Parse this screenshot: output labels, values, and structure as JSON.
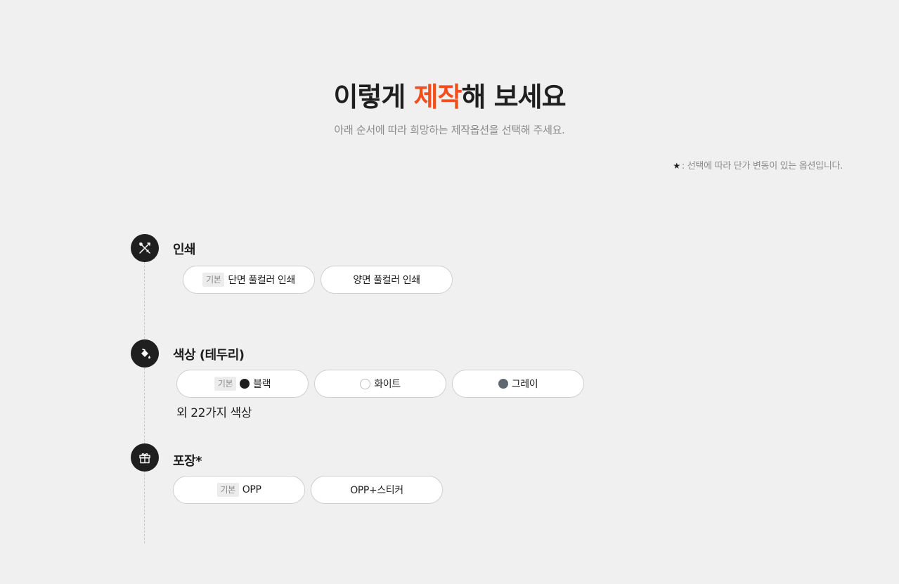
{
  "header": {
    "title_prefix": "이렇게 ",
    "title_accent": "제작",
    "title_suffix": "해 보세요",
    "subtitle": "아래 순서에 따라 희망하는 제작옵션을 선택해 주세요."
  },
  "note": {
    "star": "★",
    "text": ": 선택에 따라 단가 변동이 있는 옵션입니다."
  },
  "colors": {
    "accent": "#f24e1e",
    "dark": "#1f1f1f",
    "muted": "#8b8b8b",
    "background": "#f0f0f0"
  },
  "steps": [
    {
      "icon": "scissors-pencil-icon",
      "title": "인쇄",
      "options": [
        {
          "badge": "기본",
          "label": "단면 풀컬러 인쇄"
        },
        {
          "label": "양면 풀컬러 인쇄"
        }
      ]
    },
    {
      "icon": "paint-bucket-icon",
      "title": "색상 (테두리)",
      "options": [
        {
          "badge": "기본",
          "swatch": "#1f1f1f",
          "label": "블랙"
        },
        {
          "swatch": "#ffffff",
          "label": "화이트"
        },
        {
          "swatch": "#5f6870",
          "label": "그레이"
        }
      ],
      "extra": "외 22가지 색상"
    },
    {
      "icon": "gift-icon",
      "title": "포장*",
      "options": [
        {
          "badge": "기본",
          "label": "OPP"
        },
        {
          "label": "OPP+스티커"
        }
      ]
    }
  ]
}
